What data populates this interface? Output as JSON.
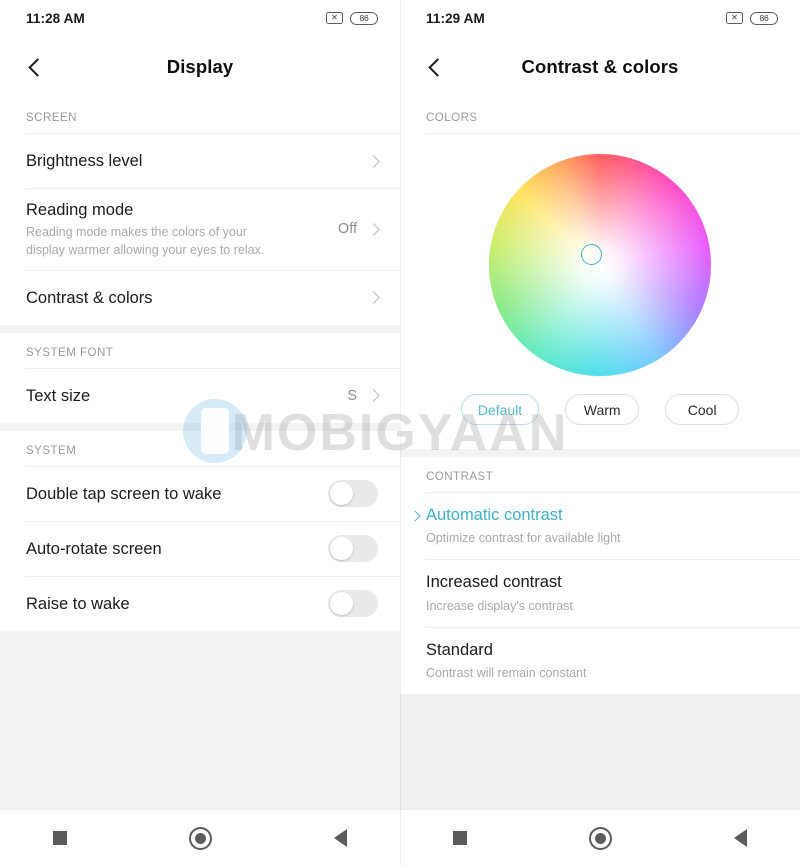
{
  "watermark": {
    "text": "MOBIGYAAN",
    "icon": "phone-icon"
  },
  "left_screen": {
    "status": {
      "time": "11:28 AM",
      "mute_icon": "mute-icon",
      "battery_icon": "battery-icon",
      "battery_level": "86"
    },
    "appbar": {
      "back_icon": "chevron-left-icon",
      "title": "Display"
    },
    "sections": [
      {
        "header": "SCREEN",
        "rows": [
          {
            "title": "Brightness level",
            "sub": "",
            "value": "",
            "control": "chevron",
            "icon": "chevron-right-icon"
          },
          {
            "title": "Reading mode",
            "sub": "Reading mode makes the colors of your display warmer allowing your eyes to relax.",
            "value": "Off",
            "control": "chevron",
            "icon": "chevron-right-icon"
          },
          {
            "title": "Contrast & colors",
            "sub": "",
            "value": "",
            "control": "chevron",
            "icon": "chevron-right-icon"
          }
        ]
      },
      {
        "header": "SYSTEM FONT",
        "rows": [
          {
            "title": "Text size",
            "sub": "",
            "value": "S",
            "control": "chevron",
            "icon": "chevron-right-icon"
          }
        ]
      },
      {
        "header": "SYSTEM",
        "rows": [
          {
            "title": "Double tap screen to wake",
            "sub": "",
            "value": "",
            "control": "toggle",
            "state": "off"
          },
          {
            "title": "Auto-rotate screen",
            "sub": "",
            "value": "",
            "control": "toggle",
            "state": "off"
          },
          {
            "title": "Raise to wake",
            "sub": "",
            "value": "",
            "control": "toggle",
            "state": "off"
          }
        ]
      }
    ],
    "navbar": {
      "recents_icon": "square-recents-icon",
      "home_icon": "circle-home-icon",
      "back_icon": "triangle-back-icon"
    }
  },
  "right_screen": {
    "status": {
      "time": "11:29 AM",
      "mute_icon": "mute-icon",
      "battery_icon": "battery-icon",
      "battery_level": "86"
    },
    "appbar": {
      "back_icon": "chevron-left-icon",
      "title": "Contrast & colors"
    },
    "colors": {
      "header": "COLORS",
      "wheel_icon": "color-wheel",
      "selector_icon": "wheel-selector-ring",
      "chips": [
        {
          "label": "Default",
          "selected": true
        },
        {
          "label": "Warm",
          "selected": false
        },
        {
          "label": "Cool",
          "selected": false
        }
      ]
    },
    "contrast": {
      "header": "CONTRAST",
      "options": [
        {
          "title": "Automatic contrast",
          "sub": "Optimize contrast for available light",
          "selected": true,
          "marker_icon": "chevron-right-icon"
        },
        {
          "title": "Increased contrast",
          "sub": "Increase display's contrast",
          "selected": false,
          "marker_icon": ""
        },
        {
          "title": "Standard",
          "sub": "Contrast will remain constant",
          "selected": false,
          "marker_icon": ""
        }
      ]
    },
    "navbar": {
      "recents_icon": "square-recents-icon",
      "home_icon": "circle-home-icon",
      "back_icon": "triangle-back-icon"
    }
  },
  "colors": {
    "accent_teal": "#3eb1c4",
    "chip_active_border": "#b6e0e8",
    "text_primary": "#1b1b1b",
    "text_secondary": "#a9a9a9",
    "section_header": "#9a9a9a",
    "toggle_track_off": "#e9e9e9",
    "page_background": "#f3f3f3",
    "card_background": "#ffffff"
  }
}
